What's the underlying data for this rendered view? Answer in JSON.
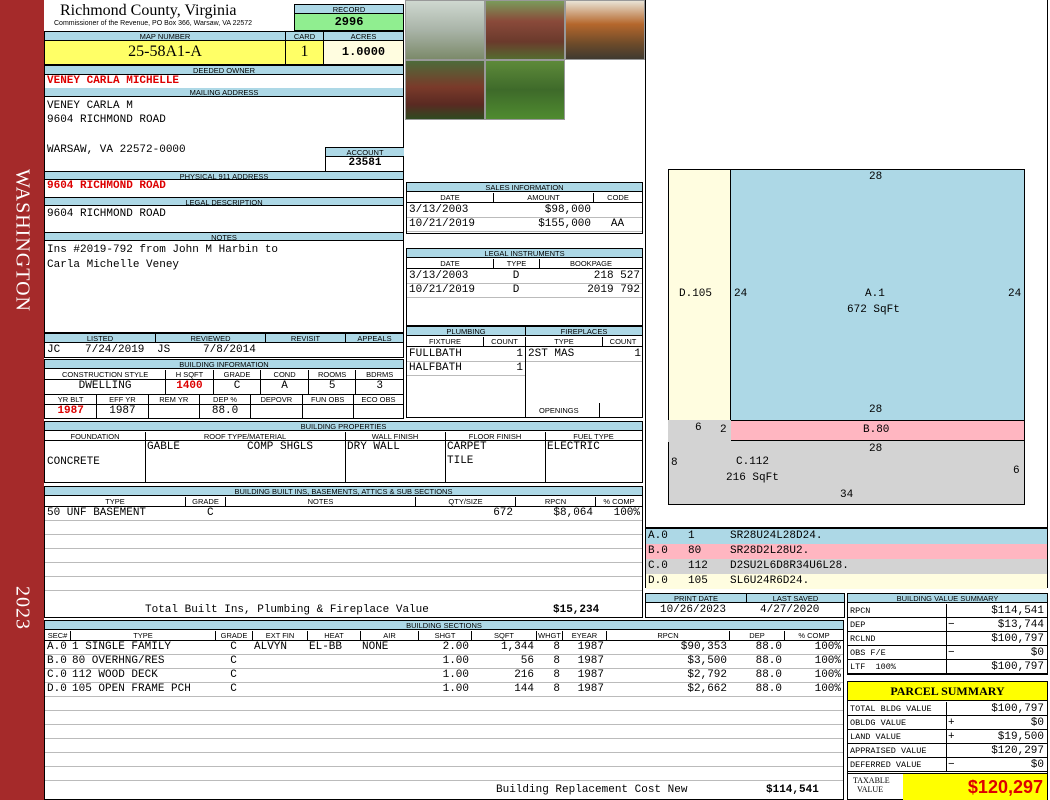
{
  "side": {
    "top": "WASHINGTON",
    "bottom": "2023"
  },
  "header": {
    "county": "Richmond County, Virginia",
    "commissioner": "Commissioner of the Revenue, PO Box 366, Warsaw, VA 22572",
    "record_label": "RECORD",
    "record": "2996",
    "map_label": "MAP NUMBER",
    "map": "25-58A1-A",
    "card_label": "CARD",
    "card": "1",
    "acres_label": "ACRES",
    "acres": "1.0000"
  },
  "owner": {
    "label": "DEEDED OWNER",
    "name": "VENEY CARLA MICHELLE",
    "mail_label": "MAILING ADDRESS",
    "mail1": "VENEY CARLA M",
    "mail2": "9604 RICHMOND ROAD",
    "mail3": "WARSAW, VA 22572-0000",
    "account_label": "ACCOUNT",
    "account": "23581",
    "phys_label": "PHYSICAL 911 ADDRESS",
    "phys": "9604 RICHMOND ROAD",
    "legal_label": "LEGAL DESCRIPTION",
    "legal": "9604 RICHMOND ROAD",
    "notes_label": "NOTES",
    "notes1": "Ins #2019-792 from John M Harbin to",
    "notes2": "Carla Michelle Veney"
  },
  "listing": {
    "listed_label": "LISTED",
    "reviewed_label": "REVIEWED",
    "revisit_label": "REVISIT",
    "appeals_label": "APPEALS",
    "listed_by": "JC",
    "listed_date": "7/24/2019",
    "reviewed_by": "JS",
    "reviewed_date": "7/8/2014"
  },
  "bldg": {
    "label": "BUILDING INFORMATION",
    "h": [
      "CONSTRUCTION STYLE",
      "H SQFT",
      "GRADE",
      "COND",
      "ROOMS",
      "BDRMS"
    ],
    "v": [
      "DWELLING",
      "1400",
      "C",
      "A",
      "5",
      "3"
    ],
    "h2": [
      "YR BLT",
      "EFF YR",
      "REM YR",
      "DEP %",
      "DEPOVR",
      "FUN OBS",
      "ECO OBS"
    ],
    "v2": [
      "1987",
      "1987",
      "",
      "88.0",
      "",
      "",
      ""
    ]
  },
  "sales": {
    "label": "SALES INFORMATION",
    "h": [
      "DATE",
      "AMOUNT",
      "CODE"
    ],
    "rows": [
      [
        "3/13/2003",
        "$98,000",
        ""
      ],
      [
        "10/21/2019",
        "$155,000",
        "AA"
      ]
    ]
  },
  "legal": {
    "label": "LEGAL INSTRUMENTS",
    "h": [
      "DATE",
      "TYPE",
      "BOOKPAGE"
    ],
    "rows": [
      [
        "3/13/2003",
        "D",
        "218 527"
      ],
      [
        "10/21/2019",
        "D",
        "2019 792"
      ]
    ]
  },
  "plumb": {
    "label": "PLUMBING",
    "h": [
      "FIXTURE",
      "COUNT"
    ],
    "rows": [
      [
        "FULLBATH",
        "1"
      ],
      [
        "HALFBATH",
        "1"
      ]
    ]
  },
  "fire": {
    "label": "FIREPLACES",
    "h": [
      "TYPE",
      "COUNT"
    ],
    "rows": [
      [
        "2ST MAS",
        "1"
      ]
    ],
    "openings": "OPENINGS"
  },
  "props": {
    "label": "BUILDING PROPERTIES",
    "h": [
      "FOUNDATION",
      "ROOF TYPE/MATERIAL",
      "WALL FINISH",
      "FLOOR FINISH",
      "FUEL TYPE"
    ],
    "foundation": "CONCRETE",
    "roof1": "GABLE",
    "roof2": "COMP SHGLS",
    "wall": "DRY WALL",
    "floor1": "CARPET",
    "floor2": "TILE",
    "fuel": "ELECTRIC"
  },
  "builtins": {
    "label": "BUILDING BUILT INS, BASEMENTS, ATTICS & SUB SECTIONS",
    "h": [
      "TYPE",
      "GRADE",
      "NOTES",
      "QTY/SIZE",
      "RPCN",
      "% COMP"
    ],
    "rows": [
      [
        "50 UNF BASEMENT",
        "C",
        "",
        "672",
        "$8,064",
        "100%"
      ]
    ],
    "total_label": "Total Built Ins, Plumbing & Fireplace Value",
    "total": "$15,234"
  },
  "sections": {
    "label": "BUILDING SECTIONS",
    "h": [
      "SEC#",
      "TYPE",
      "GRADE",
      "EXT FIN",
      "HEAT",
      "AIR",
      "SHGT",
      "SQFT",
      "WHGT",
      "EYEAR",
      "RPCN",
      "DEP",
      "% COMP"
    ],
    "rows": [
      [
        "A.0",
        "1 SINGLE FAMILY",
        "C",
        "ALVYN",
        "EL-BB",
        "NONE",
        "2.00",
        "1,344",
        "8",
        "1987",
        "$90,353",
        "88.0",
        "100%"
      ],
      [
        "B.0",
        "80 OVERHNG/RES",
        "C",
        "",
        "",
        "",
        "1.00",
        "56",
        "8",
        "1987",
        "$3,500",
        "88.0",
        "100%"
      ],
      [
        "C.0",
        "112 WOOD DECK",
        "C",
        "",
        "",
        "",
        "1.00",
        "216",
        "8",
        "1987",
        "$2,792",
        "88.0",
        "100%"
      ],
      [
        "D.0",
        "105 OPEN FRAME PCH",
        "C",
        "",
        "",
        "",
        "1.00",
        "144",
        "8",
        "1987",
        "$2,662",
        "88.0",
        "100%"
      ]
    ],
    "repl_label": "Building Replacement Cost New",
    "repl": "$114,541"
  },
  "sketch": {
    "top": "28",
    "a_left": "24",
    "a_right": "24",
    "a_label": "A.1",
    "a_area": "672 SqFt",
    "a_bottom": "28",
    "d_label": "D.105",
    "b_left6": "6",
    "b_left2": "2",
    "b_label": "B.80",
    "c_top": "28",
    "c_left": "8",
    "c_label": "C.112",
    "c_area": "216 SqFt",
    "c_right": "6",
    "c_bottom": "34"
  },
  "legend": [
    {
      "code": "A.0",
      "num": "1",
      "desc": "SR28U24L28D24.",
      "color": "#add8e6"
    },
    {
      "code": "B.0",
      "num": "80",
      "desc": "SR28D2L28U2.",
      "color": "#ffb6c1"
    },
    {
      "code": "C.0",
      "num": "112",
      "desc": "D2SU2L6D8R34U6L28.",
      "color": "#d3d3d3"
    },
    {
      "code": "D.0",
      "num": "105",
      "desc": "SL6U24R6D24.",
      "color": "#fffde0"
    }
  ],
  "dates": {
    "print_label": "PRINT DATE",
    "saved_label": "LAST SAVED",
    "print": "10/26/2023",
    "saved": "4/27/2020"
  },
  "bvs": {
    "label": "BUILDING VALUE SUMMARY",
    "rows": [
      [
        "RPCN",
        "",
        "$114,541"
      ],
      [
        "DEP",
        "−",
        "$13,744"
      ],
      [
        "RCLND",
        "",
        "$100,797"
      ],
      [
        "OBS F/E",
        "−",
        "$0"
      ],
      [
        "LTF  100%",
        "",
        "$100,797"
      ]
    ]
  },
  "parcel": {
    "label": "PARCEL SUMMARY",
    "rows": [
      [
        "TOTAL BLDG VALUE",
        "",
        "$100,797"
      ],
      [
        "OBLDG VALUE",
        "+",
        "$0"
      ],
      [
        "LAND VALUE",
        "+",
        "$19,500"
      ],
      [
        "APPRAISED VALUE",
        "",
        "$120,297"
      ],
      [
        "DEFERRED VALUE",
        "−",
        "$0"
      ]
    ],
    "taxable_label1": "TAXABLE",
    "taxable_label2": "VALUE",
    "taxable": "$120,297"
  }
}
